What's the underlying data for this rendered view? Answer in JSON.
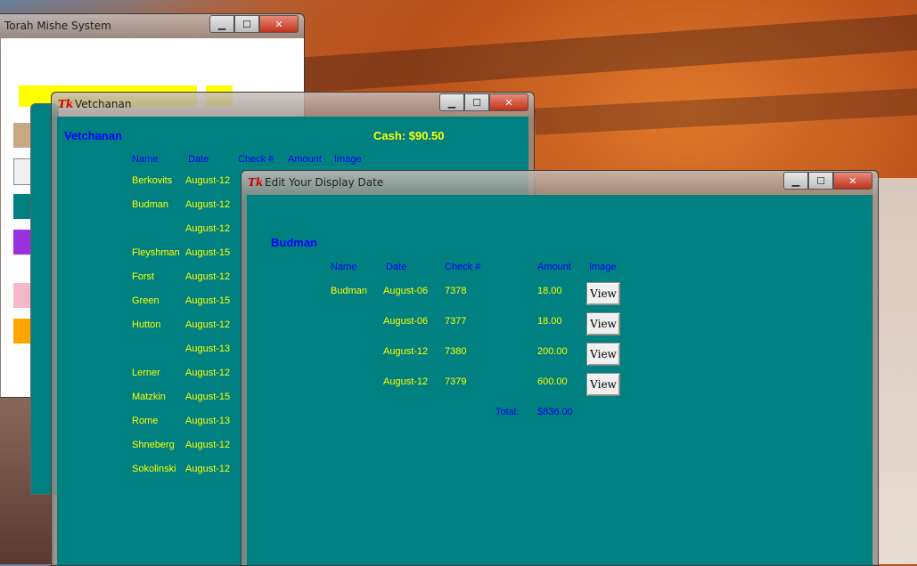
{
  "main_window": {
    "title": "Torah Mishe System"
  },
  "vetchanan_window": {
    "title": "Vetchanan",
    "heading": "Vetchanan",
    "cash": "Cash: $90.50",
    "headers": [
      "Name",
      "Date",
      "Check #",
      "Amount",
      "Image"
    ],
    "rows": [
      {
        "name": "Berkovits",
        "date": "August-12"
      },
      {
        "name": "Budman",
        "date": "August-12"
      },
      {
        "name": "",
        "date": "August-12"
      },
      {
        "name": "Fleyshman",
        "date": "August-15"
      },
      {
        "name": "Forst",
        "date": "August-12"
      },
      {
        "name": "Green",
        "date": "August-15"
      },
      {
        "name": "Hutton",
        "date": "August-12"
      },
      {
        "name": "",
        "date": "August-13"
      },
      {
        "name": "Lerner",
        "date": "August-12"
      },
      {
        "name": "Matzkin",
        "date": "August-15"
      },
      {
        "name": "Rome",
        "date": "August-13"
      },
      {
        "name": "Shneberg",
        "date": "August-12"
      },
      {
        "name": "Sokolinski",
        "date": "August-12"
      }
    ]
  },
  "edit_window": {
    "title": "Edit Your Display Date",
    "heading": "Budman",
    "headers": [
      "Name",
      "Date",
      "Check #",
      "Amount",
      "Image"
    ],
    "rows": [
      {
        "name": "Budman",
        "date": "August-06",
        "check": "7378",
        "amount": "18.00",
        "button": "View"
      },
      {
        "name": "",
        "date": "August-06",
        "check": "7377",
        "amount": "18.00",
        "button": "View"
      },
      {
        "name": "",
        "date": "August-12",
        "check": "7380",
        "amount": "200.00",
        "button": "View"
      },
      {
        "name": "",
        "date": "August-12",
        "check": "7379",
        "amount": "600.00",
        "button": "View"
      }
    ],
    "total_label": "Total:",
    "total_value": "$836.00"
  },
  "window_controls": {
    "minimize": "▁",
    "maximize": "☐",
    "close": "✕"
  },
  "icons": {
    "app_icon": "Tk"
  },
  "colors": {
    "panel_bg": "#008080",
    "header_text": "#0000ff",
    "data_text": "#ffff00"
  }
}
